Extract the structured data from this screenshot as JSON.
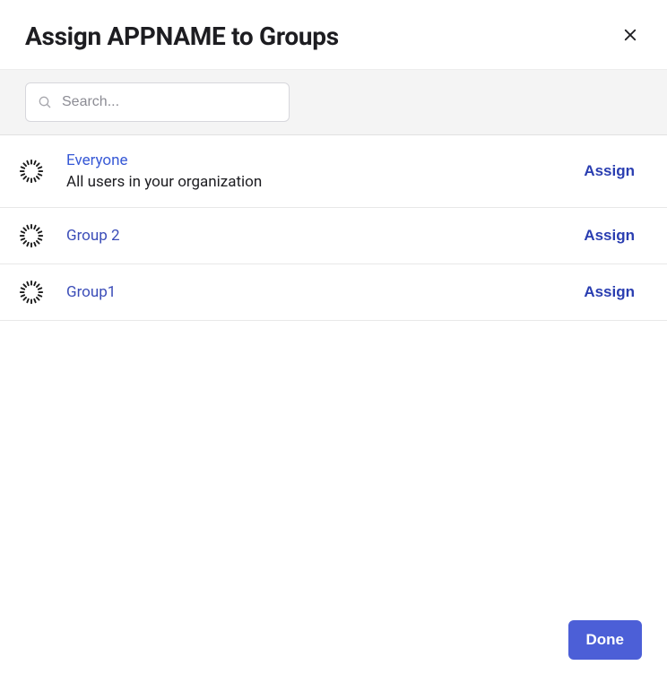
{
  "header": {
    "title": "Assign APPNAME to Groups"
  },
  "search": {
    "placeholder": "Search...",
    "value": ""
  },
  "groups": [
    {
      "name": "Everyone",
      "description": "All users in your organization",
      "action_label": "Assign",
      "is_link": true
    },
    {
      "name": "Group 2",
      "description": "",
      "action_label": "Assign",
      "is_link": false
    },
    {
      "name": "Group1",
      "description": "",
      "action_label": "Assign",
      "is_link": false
    }
  ],
  "footer": {
    "done_label": "Done"
  }
}
